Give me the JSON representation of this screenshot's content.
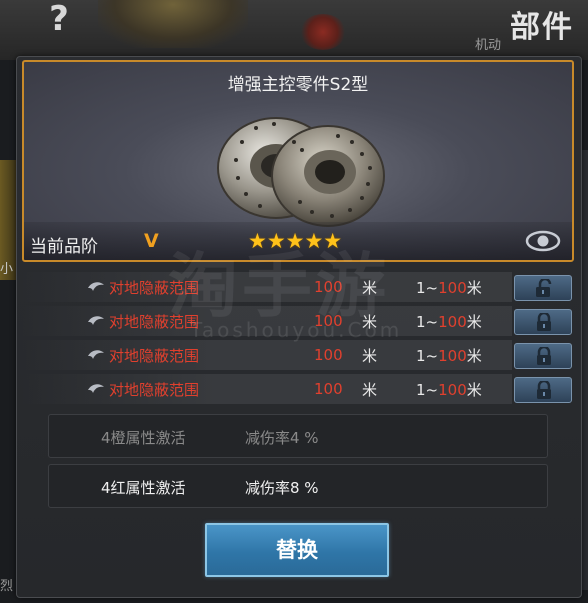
{
  "header": {
    "help_glyph": "?",
    "title": "部件",
    "subtitle": "机动"
  },
  "side": {
    "left_label_1": "小",
    "left_label_2": "烈"
  },
  "item": {
    "name": "增强主控零件S2型",
    "grade_label": "当前品阶",
    "grade_value": "V",
    "stars": "★★★★★",
    "star_count": 5
  },
  "attributes": [
    {
      "name": "对地隐蔽范围",
      "value": "100",
      "unit": "米",
      "range_min": "1~",
      "range_max": "100",
      "range_unit": "米",
      "lock": "unlocked"
    },
    {
      "name": "对地隐蔽范围",
      "value": "100",
      "unit": "米",
      "range_min": "1~",
      "range_max": "100",
      "range_unit": "米",
      "lock": "locked"
    },
    {
      "name": "对地隐蔽范围",
      "value": "100",
      "unit": "米",
      "range_min": "1~",
      "range_max": "100",
      "range_unit": "米",
      "lock": "locked"
    },
    {
      "name": "对地隐蔽范围",
      "value": "100",
      "unit": "米",
      "range_min": "1~",
      "range_max": "100",
      "range_unit": "米",
      "lock": "locked"
    }
  ],
  "bonuses": [
    {
      "name": "4橙属性激活",
      "value": "减伤率4 %",
      "active": false
    },
    {
      "name": "4红属性激活",
      "value": "减伤率8 %",
      "active": true
    }
  ],
  "actions": {
    "replace_label": "替换"
  },
  "watermark": {
    "text": "淘手游",
    "url": "Taoshouyou.Com"
  },
  "colors": {
    "highlight_red": "#e0402e",
    "grade_gold": "#f0a020",
    "frame_orange": "#c88a2a",
    "button_blue": "#3a86b8"
  }
}
